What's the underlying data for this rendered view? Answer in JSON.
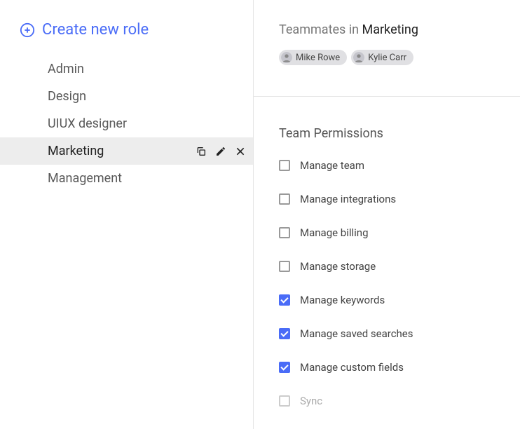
{
  "sidebar": {
    "create_label": "Create new role",
    "roles": [
      {
        "label": "Admin",
        "selected": false
      },
      {
        "label": "Design",
        "selected": false
      },
      {
        "label": "UIUX designer",
        "selected": false
      },
      {
        "label": "Marketing",
        "selected": true
      },
      {
        "label": "Management",
        "selected": false
      }
    ]
  },
  "main": {
    "teammates_prefix": "Teammates in ",
    "role_name": "Marketing",
    "teammates": [
      {
        "name": "Mike Rowe"
      },
      {
        "name": "Kylie Carr"
      }
    ],
    "permissions_title": "Team Permissions",
    "permissions": [
      {
        "label": "Manage team",
        "checked": false
      },
      {
        "label": "Manage integrations",
        "checked": false
      },
      {
        "label": "Manage billing",
        "checked": false
      },
      {
        "label": "Manage storage",
        "checked": false
      },
      {
        "label": "Manage keywords",
        "checked": true
      },
      {
        "label": "Manage saved searches",
        "checked": true
      },
      {
        "label": "Manage custom fields",
        "checked": true
      },
      {
        "label": "Sync",
        "checked": false,
        "grey": true
      }
    ]
  },
  "colors": {
    "accent": "#4a6cf7"
  }
}
